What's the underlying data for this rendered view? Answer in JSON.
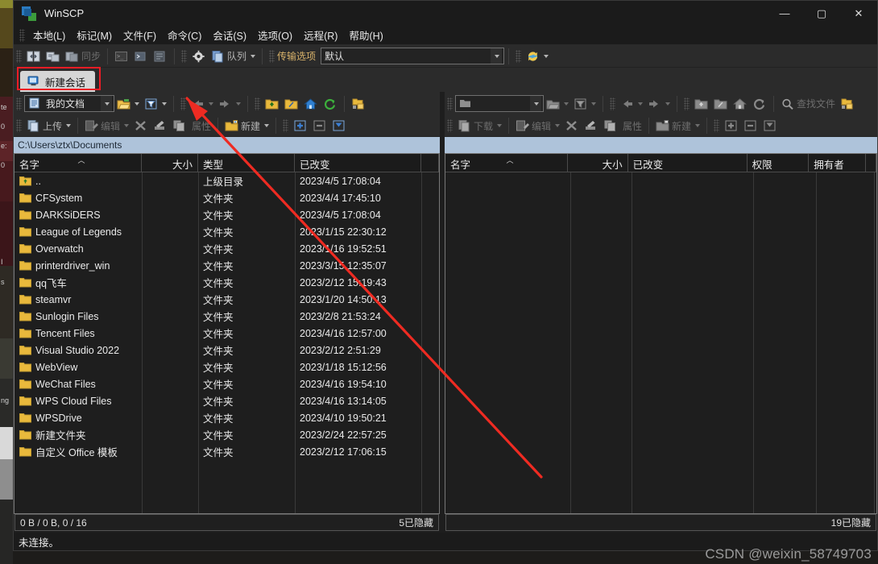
{
  "window": {
    "title": "WinSCP",
    "icon": "winscp-icon",
    "minimize": "—",
    "maximize": "▢",
    "close": "✕"
  },
  "menu": [
    {
      "label": "本地(L)",
      "name": "menu-local"
    },
    {
      "label": "标记(M)",
      "name": "menu-mark"
    },
    {
      "label": "文件(F)",
      "name": "menu-file"
    },
    {
      "label": "命令(C)",
      "name": "menu-command"
    },
    {
      "label": "会话(S)",
      "name": "menu-session"
    },
    {
      "label": "选项(O)",
      "name": "menu-options"
    },
    {
      "label": "远程(R)",
      "name": "menu-remote"
    },
    {
      "label": "帮助(H)",
      "name": "menu-help"
    }
  ],
  "toolbar": {
    "sync_label": "同步",
    "queue_label": "队列",
    "transfer_settings_label": "传输选项",
    "transfer_settings_value": "默认"
  },
  "session_tab": {
    "label": "新建会话",
    "icon": "new-session-icon"
  },
  "left_pane": {
    "drive_value": "我的文档",
    "drive_icon": "my-documents-icon",
    "path": "C:\\Users\\ztx\\Documents",
    "actions": {
      "upload": "上传",
      "edit": "编辑",
      "properties": "属性",
      "new": "新建"
    },
    "columns": [
      {
        "label": "名字",
        "align": "left",
        "width": 158,
        "sorted": true
      },
      {
        "label": "大小",
        "align": "right",
        "width": 70
      },
      {
        "label": "类型",
        "align": "left",
        "width": 120
      },
      {
        "label": "已改变",
        "align": "left",
        "width": 157
      },
      {
        "label": "",
        "align": "left",
        "width": 24
      }
    ],
    "rows": [
      {
        "name": "..",
        "size": "",
        "type": "上级目录",
        "changed": "2023/4/5  17:08:04",
        "icon": "folder-up-icon"
      },
      {
        "name": "CFSystem",
        "size": "",
        "type": "文件夹",
        "changed": "2023/4/4  17:45:10",
        "icon": "folder-icon"
      },
      {
        "name": "DARKSiDERS",
        "size": "",
        "type": "文件夹",
        "changed": "2023/4/5  17:08:04",
        "icon": "folder-icon"
      },
      {
        "name": "League of Legends",
        "size": "",
        "type": "文件夹",
        "changed": "2023/1/15  22:30:12",
        "icon": "folder-icon"
      },
      {
        "name": "Overwatch",
        "size": "",
        "type": "文件夹",
        "changed": "2023/1/16  19:52:51",
        "icon": "folder-icon"
      },
      {
        "name": "printerdriver_win",
        "size": "",
        "type": "文件夹",
        "changed": "2023/3/15  12:35:07",
        "icon": "folder-icon"
      },
      {
        "name": "qq飞车",
        "size": "",
        "type": "文件夹",
        "changed": "2023/2/12  15:19:43",
        "icon": "folder-icon"
      },
      {
        "name": "steamvr",
        "size": "",
        "type": "文件夹",
        "changed": "2023/1/20  14:50:13",
        "icon": "folder-icon"
      },
      {
        "name": "Sunlogin Files",
        "size": "",
        "type": "文件夹",
        "changed": "2023/2/8  21:53:24",
        "icon": "folder-icon"
      },
      {
        "name": "Tencent Files",
        "size": "",
        "type": "文件夹",
        "changed": "2023/4/16  12:57:00",
        "icon": "folder-icon"
      },
      {
        "name": "Visual Studio 2022",
        "size": "",
        "type": "文件夹",
        "changed": "2023/2/12  2:51:29",
        "icon": "folder-icon"
      },
      {
        "name": "WebView",
        "size": "",
        "type": "文件夹",
        "changed": "2023/1/18  15:12:56",
        "icon": "folder-icon"
      },
      {
        "name": "WeChat Files",
        "size": "",
        "type": "文件夹",
        "changed": "2023/4/16  19:54:10",
        "icon": "folder-icon"
      },
      {
        "name": "WPS Cloud Files",
        "size": "",
        "type": "文件夹",
        "changed": "2023/4/16  13:14:05",
        "icon": "folder-icon"
      },
      {
        "name": "WPSDrive",
        "size": "",
        "type": "文件夹",
        "changed": "2023/4/10  19:50:21",
        "icon": "folder-icon"
      },
      {
        "name": "新建文件夹",
        "size": "",
        "type": "文件夹",
        "changed": "2023/2/24  22:57:25",
        "icon": "folder-icon"
      },
      {
        "name": "自定义 Office 模板",
        "size": "",
        "type": "文件夹",
        "changed": "2023/2/12  17:06:15",
        "icon": "folder-icon"
      }
    ],
    "status_left": "0 B / 0 B,  0 / 16",
    "status_right": "5已隐藏"
  },
  "right_pane": {
    "drive_value": "",
    "path": "",
    "actions": {
      "download": "下载",
      "edit": "编辑",
      "properties": "属性",
      "new": "新建",
      "find_files": "查找文件"
    },
    "columns": [
      {
        "label": "名字",
        "align": "left",
        "width": 155,
        "sorted": true
      },
      {
        "label": "大小",
        "align": "right",
        "width": 76
      },
      {
        "label": "已改变",
        "align": "left",
        "width": 151
      },
      {
        "label": "权限",
        "align": "left",
        "width": 78
      },
      {
        "label": "拥有者",
        "align": "left",
        "width": 72
      },
      {
        "label": "",
        "align": "left",
        "width": 20
      }
    ],
    "rows": [],
    "status_left": "",
    "status_right": "19已隐藏"
  },
  "connection_status": "未连接。",
  "watermark": "CSDN @weixin_58749703",
  "annotations": {
    "highlight_color": "#ee1c25",
    "highlight_target": "新建会话"
  },
  "desktop_fragments": [
    "te",
    "0",
    "e:",
    "0",
    "I",
    "s",
    "ng",
    "ᄇ"
  ]
}
